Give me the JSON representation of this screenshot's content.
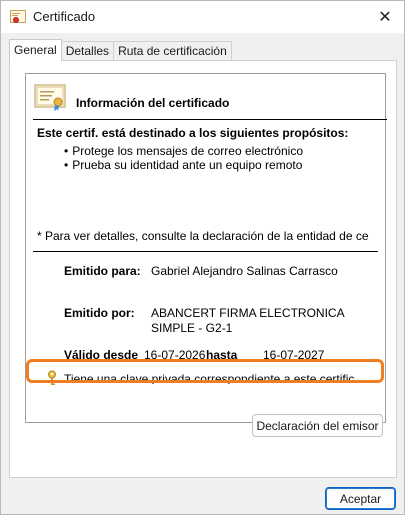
{
  "window": {
    "title": "Certificado"
  },
  "tabs": [
    {
      "label": "General",
      "active": true
    },
    {
      "label": "Detalles",
      "active": false
    },
    {
      "label": "Ruta de certificación",
      "active": false
    }
  ],
  "info": {
    "title": "Información del certificado",
    "purpose_heading": "Este certif. está destinado a los siguientes propósitos:",
    "purposes": [
      "Protege los mensajes de correo electrónico",
      "Prueba su identidad ante un equipo remoto"
    ],
    "note": "* Para ver detalles, consulte la declaración de la entidad de ce",
    "issued_to_label": "Emitido para:",
    "issued_to_value": "Gabriel Alejandro Salinas Carrasco",
    "issued_by_label": "Emitido por:",
    "issued_by_value": "ABANCERT FIRMA ELECTRONICA SIMPLE - G2-1",
    "valid_from_label": "Válido desde",
    "valid_from_value": "16-07-2026",
    "valid_to_label": "hasta",
    "valid_to_value": "16-07-2027",
    "private_key_text": "Tiene una clave privada correspondiente a este certificado."
  },
  "buttons": {
    "issuer_statement": "Declaración del emisor",
    "accept": "Aceptar"
  },
  "icons": {
    "title": "certificate-icon",
    "info": "certificate-icon",
    "key": "key-icon",
    "close": "close-icon"
  },
  "colors": {
    "highlight": "#ef7d22",
    "accept_border": "#0a64c7"
  }
}
